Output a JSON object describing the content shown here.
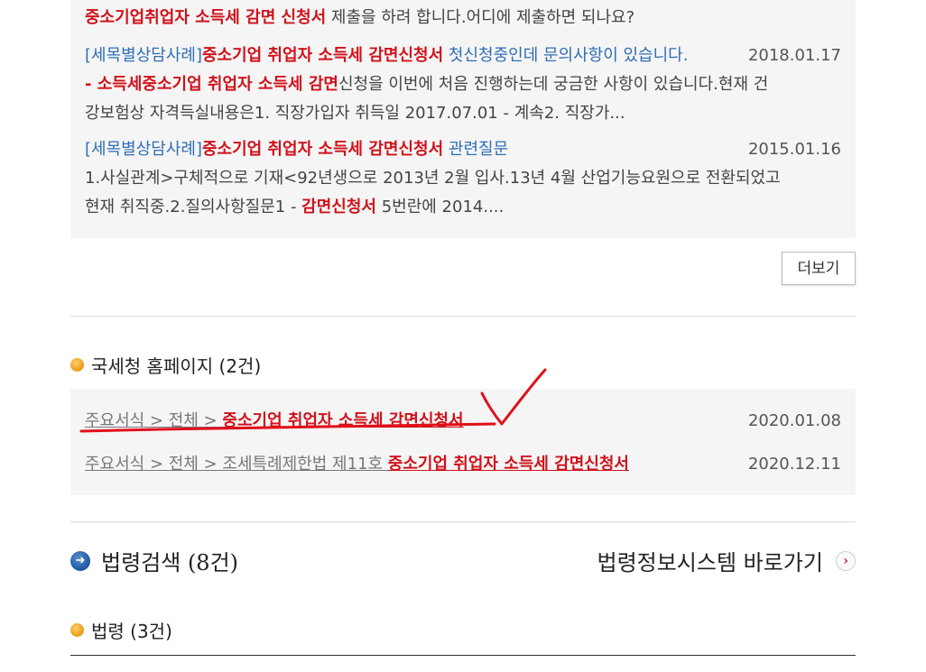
{
  "box1": {
    "top_line": {
      "bold": "중소기업취업자 소득세 감면 신청서",
      "rest": " 제출을 하려 합니다.어디에 제출하면 되나요?"
    },
    "items": [
      {
        "category": "[세목별상담사례]",
        "title_bold": "중소기업 취업자 소득세 감면신청서",
        "title_rest": " 첫신청중인데 문의사항이 있습니다.",
        "date": "2018.01.17",
        "snippet_prefix": "- ",
        "snippet_bold": "소득세중소기업 취업자 소득세 감면",
        "snippet_rest": "신청을 이번에 처음 진행하는데 궁금한 사항이 있습니다.현재 건",
        "snippet_line2": "강보험상 자격득실내용은1. 직장가입자 취득일 2017.07.01 - 계속2. 직장가..."
      },
      {
        "category": "[세목별상담사례]",
        "title_bold": "중소기업 취업자 소득세 감면신청서",
        "title_rest": " 관련질문",
        "date": "2015.01.16",
        "snippet_line1": "1.사실관계>구체적으로 기재<92년생으로 2013년 2월 입사.13년 4월 산업기능요원으로 전환되었고",
        "snippet_line2_pre": "현재 취직중.2.질의사항질문1 - ",
        "snippet_line2_bold": "감면신청서",
        "snippet_line2_rest": " 5번란에 2014...."
      }
    ]
  },
  "more_button": "더보기",
  "nts_section": {
    "title": "국세청 홈페이지 (2건)",
    "rows": [
      {
        "path": "주요서식 > 전체 > ",
        "bold": "중소기업 취업자 소득세 감면신청서",
        "date": "2020.01.08"
      },
      {
        "path": "주요서식 > 전체 > 조세특례제한법 제11호 ",
        "bold": "중소기업 취업자 소득세 감면신청서",
        "date": "2020.12.11"
      }
    ]
  },
  "law_section": {
    "title": "법령검색 (8건)",
    "link": "법령정보시스템 바로가기",
    "sub_title": "법령 (3건)"
  },
  "colors": {
    "keyword": "#d0121b",
    "category": "#2f6eb5",
    "annotation": "#e0101a"
  }
}
